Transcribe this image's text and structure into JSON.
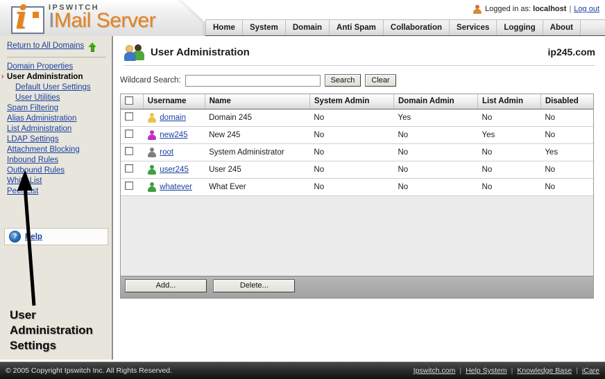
{
  "branding": {
    "brand_small": "IPSWITCH",
    "product_i": "I",
    "product_mail": "Mail",
    "product_server": "Server",
    "logo_icon": "ipswitch-i-logo"
  },
  "header": {
    "logged_in_label": "Logged in as:",
    "user": "localhost",
    "separator": "|",
    "logout_label": "Log out",
    "user_icon": "user-icon"
  },
  "nav": {
    "items": [
      {
        "label": "Home"
      },
      {
        "label": "System"
      },
      {
        "label": "Domain"
      },
      {
        "label": "Anti Spam"
      },
      {
        "label": "Collaboration"
      },
      {
        "label": "Services"
      },
      {
        "label": "Logging"
      },
      {
        "label": "About"
      }
    ]
  },
  "sidebar": {
    "return_link": "Return to All Domains",
    "return_icon": "green-up-arrow-icon",
    "items": [
      {
        "label": "Domain Properties",
        "active": false,
        "sub": false
      },
      {
        "label": "User Administration",
        "active": true,
        "sub": false
      },
      {
        "label": "Default User Settings",
        "active": false,
        "sub": true
      },
      {
        "label": "User Utilities",
        "active": false,
        "sub": true
      },
      {
        "label": "Spam Filtering",
        "active": false,
        "sub": false
      },
      {
        "label": "Alias Administration",
        "active": false,
        "sub": false
      },
      {
        "label": "List Administration",
        "active": false,
        "sub": false
      },
      {
        "label": "LDAP Settings",
        "active": false,
        "sub": false
      },
      {
        "label": "Attachment Blocking",
        "active": false,
        "sub": false
      },
      {
        "label": "Inbound Rules",
        "active": false,
        "sub": false
      },
      {
        "label": "Outbound Rules",
        "active": false,
        "sub": false
      },
      {
        "label": "White List",
        "active": false,
        "sub": false
      },
      {
        "label": "Peer List",
        "active": false,
        "sub": false
      }
    ],
    "help_label": "Help",
    "help_icon": "question-mark-icon",
    "active_marker": "›"
  },
  "annotation": {
    "caption": "User Administration Settings",
    "arrow_icon": "black-arrow-up-icon"
  },
  "main": {
    "title": "User Administration",
    "title_icon": "two-users-icon",
    "domain": "ip245.com",
    "search": {
      "label": "Wildcard Search:",
      "value": "",
      "placeholder": "",
      "search_button": "Search",
      "clear_button": "Clear"
    },
    "table": {
      "columns": [
        "",
        "Username",
        "Name",
        "System Admin",
        "Domain Admin",
        "List Admin",
        "Disabled"
      ],
      "select_all_checked": false,
      "rows": [
        {
          "checked": false,
          "icon_color": "#e8c64a",
          "username": "domain",
          "name": "Domain 245",
          "system_admin": "No",
          "domain_admin": "Yes",
          "list_admin": "No",
          "disabled": "No"
        },
        {
          "checked": false,
          "icon_color": "#c42ec4",
          "username": "new245",
          "name": "New 245",
          "system_admin": "No",
          "domain_admin": "No",
          "list_admin": "Yes",
          "disabled": "No"
        },
        {
          "checked": false,
          "icon_color": "#7e7e7e",
          "username": "root",
          "name": "System Administrator",
          "system_admin": "No",
          "domain_admin": "No",
          "list_admin": "No",
          "disabled": "Yes"
        },
        {
          "checked": false,
          "icon_color": "#3fa03f",
          "username": "user245",
          "name": "User 245",
          "system_admin": "No",
          "domain_admin": "No",
          "list_admin": "No",
          "disabled": "No"
        },
        {
          "checked": false,
          "icon_color": "#3fa03f",
          "username": "whatever",
          "name": "What Ever",
          "system_admin": "No",
          "domain_admin": "No",
          "list_admin": "No",
          "disabled": "No"
        }
      ]
    },
    "actions": {
      "add_label": "Add...",
      "delete_label": "Delete..."
    }
  },
  "footer": {
    "copyright": "© 2005 Copyright Ipswitch Inc. All Rights Reserved.",
    "links": [
      "Ipswitch.com",
      "Help System",
      "Knowledge Base",
      "iCare"
    ],
    "separator": "|"
  },
  "colors": {
    "accent_orange": "#e8821e",
    "link_blue": "#1a3fa0",
    "sidebar_bg": "#e8e6dc",
    "footer_bg": "#2a2a2a"
  }
}
